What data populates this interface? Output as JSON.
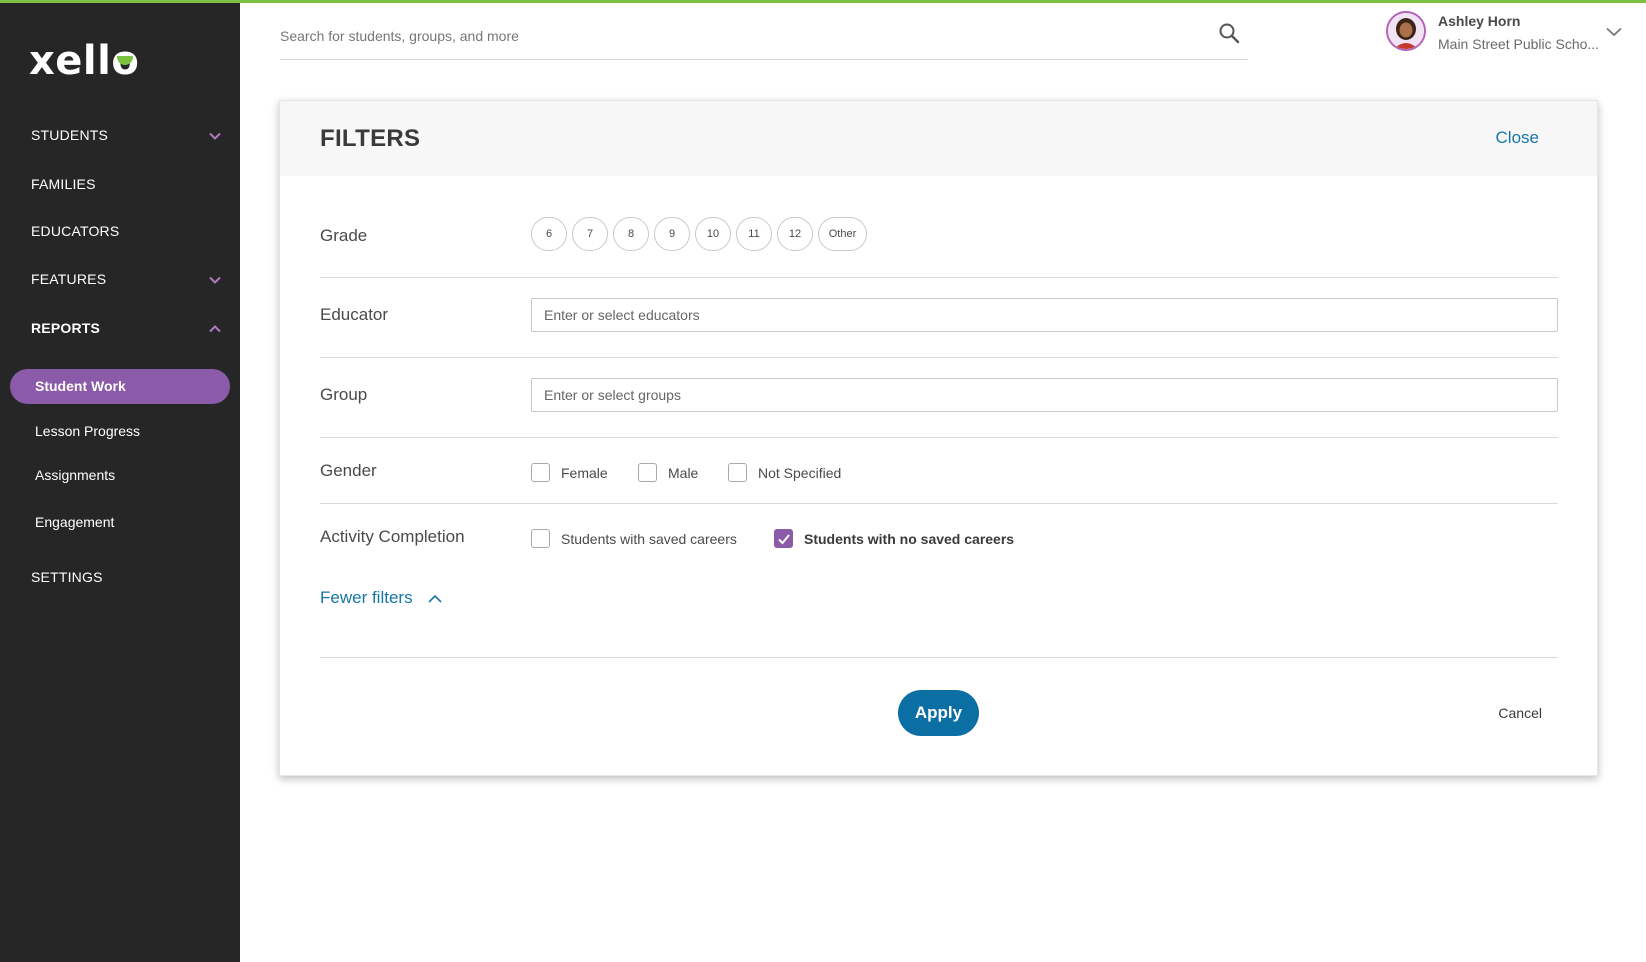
{
  "brand": {
    "logo_text": "xello",
    "accent_green": "#7cc242",
    "accent_purple": "#8b5aa8",
    "link_blue": "#1776a8",
    "button_blue": "#0b6fa4",
    "sidebar_bg": "#262626"
  },
  "sidebar": {
    "items": [
      {
        "label": "STUDENTS",
        "icon": "chevron-down-icon"
      },
      {
        "label": "FAMILIES"
      },
      {
        "label": "EDUCATORS"
      },
      {
        "label": "FEATURES",
        "icon": "chevron-down-icon"
      },
      {
        "label": "REPORTS",
        "icon": "chevron-up-icon",
        "expanded": true
      },
      {
        "label": "SETTINGS"
      }
    ],
    "reports_sub": [
      {
        "label": "Student Work",
        "selected": true
      },
      {
        "label": "Lesson Progress"
      },
      {
        "label": "Assignments"
      },
      {
        "label": "Engagement"
      }
    ]
  },
  "header": {
    "search_placeholder": "Search for students, groups, and more",
    "user_name": "Ashley Horn",
    "user_school": "Main Street Public Scho..."
  },
  "filters": {
    "title": "FILTERS",
    "close_label": "Close",
    "grade_label": "Grade",
    "grades": [
      "6",
      "7",
      "8",
      "9",
      "10",
      "11",
      "12",
      "Other"
    ],
    "educator_label": "Educator",
    "educator_placeholder": "Enter or select educators",
    "group_label": "Group",
    "group_placeholder": "Enter or select groups",
    "gender_label": "Gender",
    "gender_options": [
      {
        "label": "Female",
        "checked": false
      },
      {
        "label": "Male",
        "checked": false
      },
      {
        "label": "Not Specified",
        "checked": false
      }
    ],
    "activity_label": "Activity Completion",
    "activity_options": [
      {
        "label": "Students with saved careers",
        "checked": false
      },
      {
        "label": "Students with no saved careers",
        "checked": true
      }
    ],
    "fewer_filters_label": "Fewer filters",
    "apply_label": "Apply",
    "cancel_label": "Cancel"
  }
}
